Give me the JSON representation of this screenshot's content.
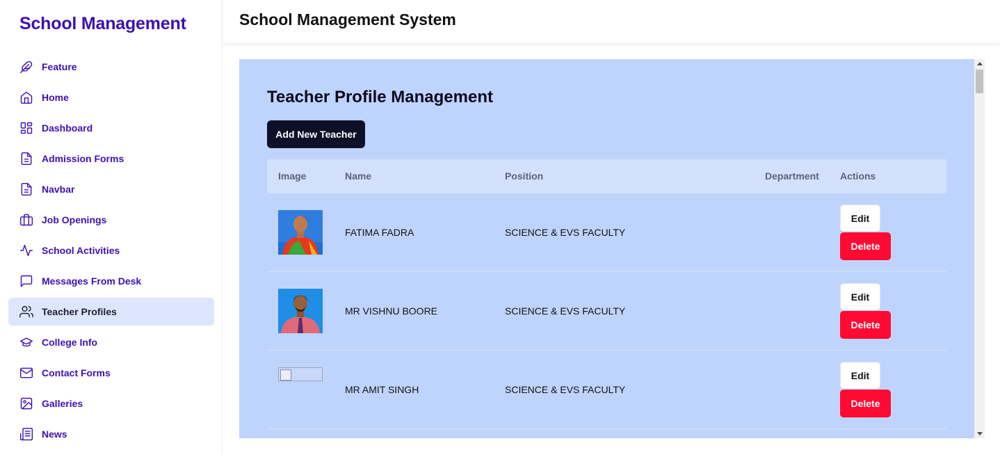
{
  "sidebar": {
    "brand": "School Management",
    "items": [
      {
        "label": "Feature",
        "icon": "feather-icon"
      },
      {
        "label": "Home",
        "icon": "home-icon"
      },
      {
        "label": "Dashboard",
        "icon": "dashboard-icon"
      },
      {
        "label": "Admission Forms",
        "icon": "document-icon"
      },
      {
        "label": "Navbar",
        "icon": "document-icon"
      },
      {
        "label": "Job Openings",
        "icon": "briefcase-icon"
      },
      {
        "label": "School Activities",
        "icon": "activity-icon"
      },
      {
        "label": "Messages From Desk",
        "icon": "message-icon"
      },
      {
        "label": "Teacher Profiles",
        "icon": "users-icon",
        "active": true
      },
      {
        "label": "College Info",
        "icon": "graduation-cap-icon"
      },
      {
        "label": "Contact Forms",
        "icon": "mail-icon"
      },
      {
        "label": "Galleries",
        "icon": "image-icon"
      },
      {
        "label": "News",
        "icon": "newspaper-icon"
      }
    ]
  },
  "header": {
    "title": "School Management System"
  },
  "main": {
    "title": "Teacher Profile Management",
    "add_button": "Add New Teacher",
    "table": {
      "headers": {
        "image": "Image",
        "name": "Name",
        "position": "Position",
        "department": "Department",
        "actions": "Actions"
      },
      "rows": [
        {
          "name": "FATIMA FADRA",
          "position": "SCIENCE & EVS FACULTY",
          "department": "",
          "edit": "Edit",
          "delete": "Delete"
        },
        {
          "name": "MR VISHNU BOORE",
          "position": "SCIENCE & EVS FACULTY",
          "department": "",
          "edit": "Edit",
          "delete": "Delete"
        },
        {
          "name": "MR AMIT SINGH",
          "position": "SCIENCE & EVS FACULTY",
          "department": "",
          "edit": "Edit",
          "delete": "Delete"
        }
      ]
    }
  },
  "colors": {
    "brand": "#3c10b5",
    "panel": "#bfd4fd",
    "active_nav": "#dde6ff",
    "primary_button": "#0f1028",
    "delete_button": "#ff0a32"
  }
}
